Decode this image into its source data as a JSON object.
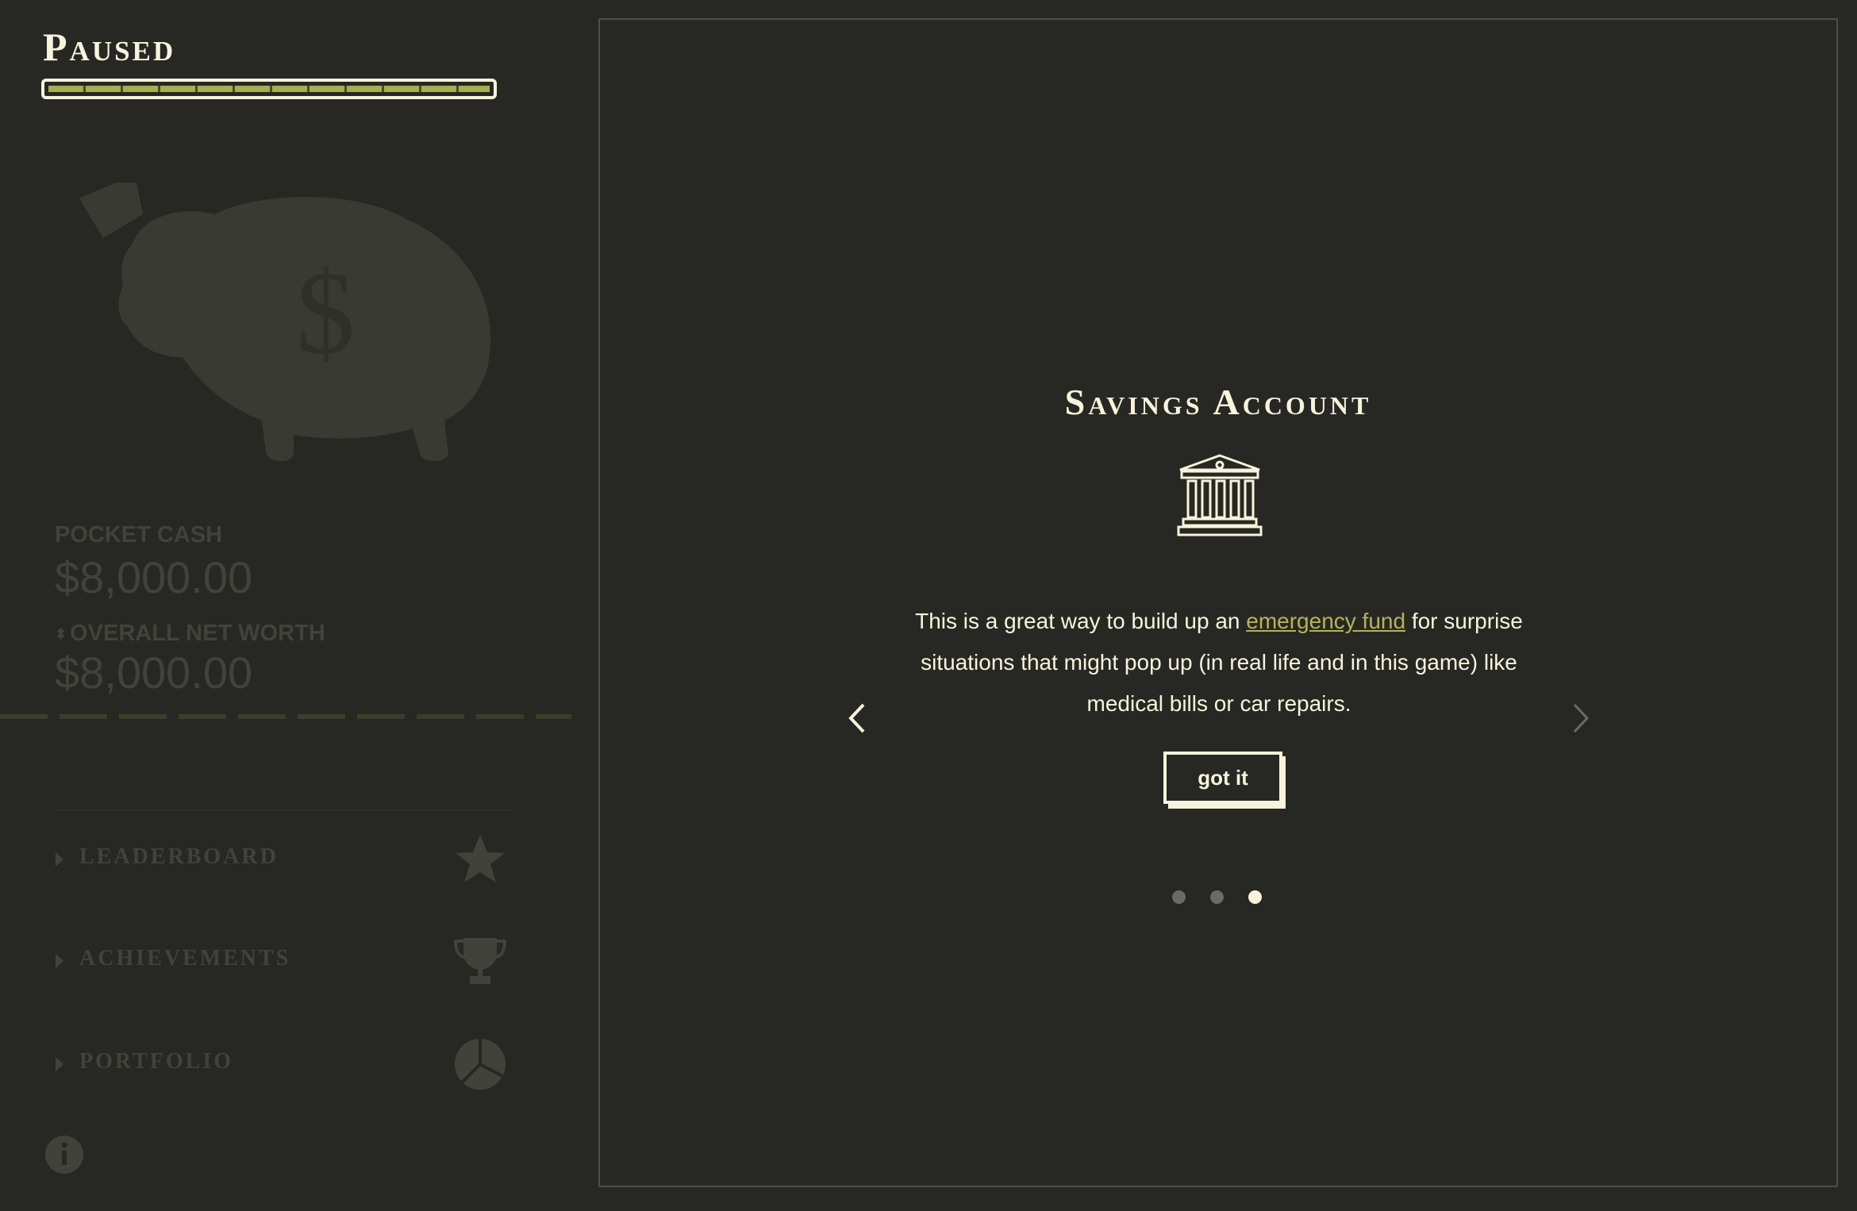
{
  "status": {
    "title": "Paused",
    "progress": 1.0
  },
  "sidebar": {
    "pocket_cash_label": "POCKET CASH",
    "pocket_cash_value": "$8,000.00",
    "net_worth_label": "OVERALL NET WORTH",
    "net_worth_value": "$8,000.00",
    "nav": [
      {
        "label": "LEADERBOARD",
        "icon": "star-icon"
      },
      {
        "label": "ACHIEVEMENTS",
        "icon": "trophy-icon"
      },
      {
        "label": "PORTFOLIO",
        "icon": "pie-chart-icon"
      }
    ]
  },
  "card": {
    "title": "Savings Account",
    "icon": "bank-icon",
    "text_before": "This is a great way to build up an ",
    "link_text": "emergency fund",
    "text_after": " for surprise situations that might pop up (in real life and in this game) like medical bills or car repairs.",
    "button_label": "got it",
    "pages": 3,
    "active_page": 3
  },
  "colors": {
    "background": "#272823",
    "foreground": "#f7f3dc",
    "accent": "#a9ac50",
    "link": "#b3b45a"
  }
}
